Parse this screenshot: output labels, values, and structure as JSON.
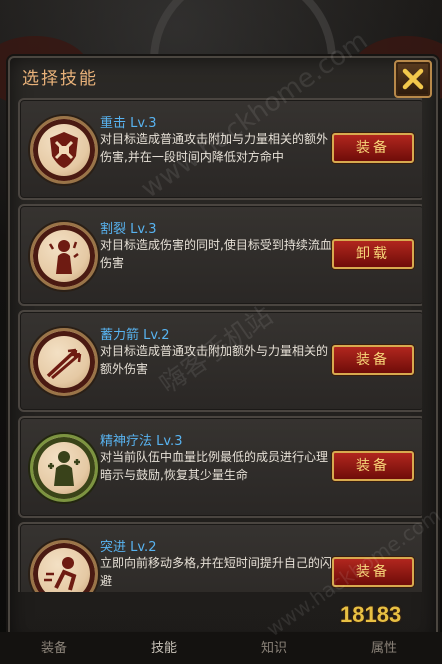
{
  "dialog": {
    "title": "选择技能"
  },
  "skills": [
    {
      "name": "重击 Lv.3",
      "desc": "对目标造成普通攻击附加与力量相关的额外伤害,并在一段时间内降低对方命中",
      "button": "装备",
      "icon": "shield-hammer-icon"
    },
    {
      "name": "割裂 Lv.3",
      "desc": "对目标造成伤害的同时,使目标受到持续流血伤害",
      "button": "卸载",
      "icon": "bleeding-figure-icon"
    },
    {
      "name": "蓄力箭 Lv.2",
      "desc": "对目标造成普通攻击附加额外与力量相关的额外伤害",
      "button": "装备",
      "icon": "arrows-icon"
    },
    {
      "name": "精神疗法 Lv.3",
      "desc": "对当前队伍中血量比例最低的成员进行心理暗示与鼓励,恢复其少量生命",
      "button": "装备",
      "icon": "healing-figure-icon"
    },
    {
      "name": "突进 Lv.2",
      "desc": "立即向前移动多格,并在短时间提升自己的闪避",
      "button": "装备",
      "icon": "dash-figure-icon"
    }
  ],
  "tabs": [
    "装备",
    "技能",
    "知识",
    "属性"
  ],
  "watermark": "嗨客手机站",
  "watermark_url": "www.hackhome.com",
  "brand": "18183",
  "colors": {
    "title": "#e9b27a",
    "skill_name": "#58b3f0",
    "button_bg": "#8b1510",
    "button_text": "#f7d679"
  }
}
